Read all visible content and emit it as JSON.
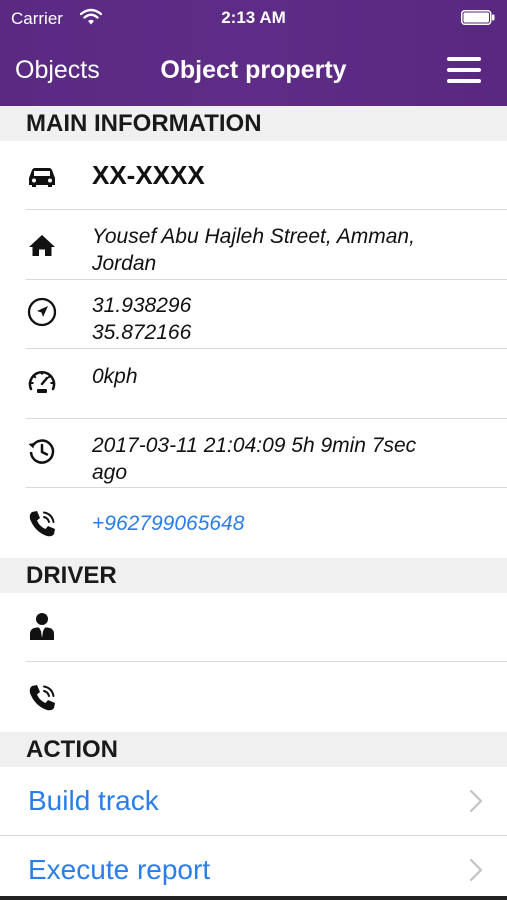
{
  "status": {
    "carrier": "Carrier",
    "time": "2:13 AM"
  },
  "nav": {
    "back_label": "Objects",
    "title": "Object property"
  },
  "sections": {
    "main": "MAIN INFORMATION",
    "driver": "DRIVER",
    "action": "ACTION"
  },
  "main_info": {
    "vehicle_name": "XX-XXXX",
    "address_line1": "Yousef Abu Hajleh Street, Amman,",
    "address_line2": "Jordan",
    "latitude": "31.938296",
    "longitude": "35.872166",
    "speed": "0kph",
    "last_update_line1": "2017-03-11 21:04:09 5h 9min 7sec",
    "last_update_line2": "ago",
    "phone": "+962799065648"
  },
  "driver": {
    "name": "",
    "phone": ""
  },
  "actions": [
    {
      "label": "Build track"
    },
    {
      "label": "Execute report"
    }
  ],
  "colors": {
    "header_bg": "#5b2a82",
    "link": "#2b7de9",
    "section_bg": "#f0f0f1"
  }
}
